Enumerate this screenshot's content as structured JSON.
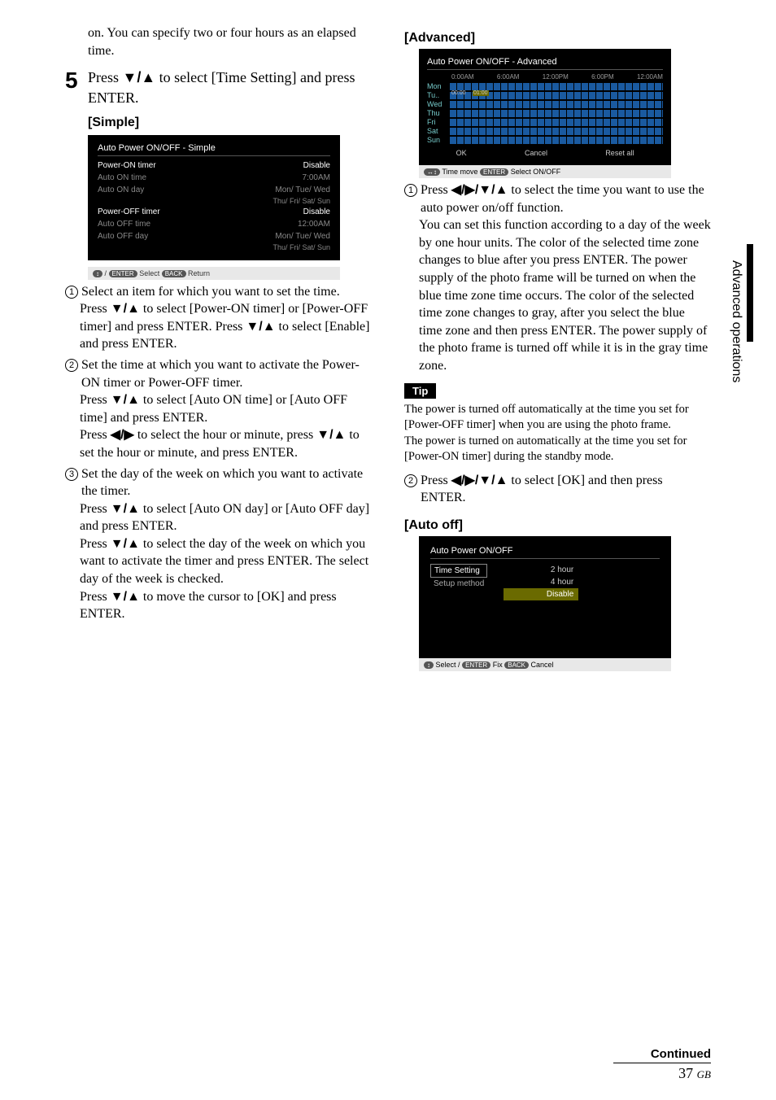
{
  "left": {
    "intro": "on. You can specify two or four hours as an elapsed time.",
    "step_number": "5",
    "step_text_a": "Press ",
    "step_arrows": "♦/♦",
    "step_text_b": " to select [Time Setting] and press ENTER.",
    "simple_label": "[Simple]",
    "simple_shot": {
      "title": "Auto Power ON/OFF - Simple",
      "r1_lab": "Power-ON timer",
      "r1_val": "Disable",
      "r2_lab": "Auto ON time",
      "r2_val": "7:00AM",
      "r3_lab": "Auto ON day",
      "r3_val": "Mon/  Tue/  Wed",
      "r3b": "Thu/   Fri/   Sat/   Sun",
      "r4_lab": "Power-OFF timer",
      "r4_val": "Disable",
      "r5_lab": "Auto OFF time",
      "r5_val": "12:00AM",
      "r6_lab": "Auto OFF day",
      "r6_val": "Mon/  Tue/  Wed",
      "r6b": "Thu/   Fri/   Sat/   Sun"
    },
    "hint": {
      "a": "↕",
      "b": "/",
      "enter": "ENTER",
      "sel": "Select",
      "back": "BACK",
      "ret": "Return"
    },
    "sub1": "Select an item for which you want to set the time.",
    "sub1b_a": "Press ",
    "sub1b_b": " to select [Power-ON timer] or [Power-OFF timer] and press ENTER. Press ",
    "sub1b_c": " to select [Enable] and press ENTER.",
    "sub2": "Set the time at which you want to activate the Power-ON timer or Power-OFF timer.",
    "sub2b_a": "Press ",
    "sub2b_b": " to select [Auto ON time] or [Auto OFF time] and press ENTER.",
    "sub2c_a": "Press ",
    "sub2c_b": " to select the hour or minute, press ",
    "sub2c_c": " to set the hour or minute, and press ENTER.",
    "sub3": "Set the day of the week on which you want to activate the timer.",
    "sub3b_a": "Press ",
    "sub3b_b": " to select [Auto ON day] or [Auto OFF day] and press ENTER.",
    "sub3c_a": "Press ",
    "sub3c_b": " to select the day of the week on which you want to activate the timer and press ENTER. The select day of the week is checked.",
    "sub3d_a": "Press ",
    "sub3d_b": " to move the cursor to [OK] and press ENTER."
  },
  "right": {
    "adv_label": "[Advanced]",
    "adv_shot": {
      "title": "Auto Power ON/OFF - Advanced",
      "times": [
        "0:00AM",
        "6:00AM",
        "12:00PM",
        "6:00PM",
        "12:00AM"
      ],
      "days": [
        "Mon",
        "Tu..",
        "Wed",
        "Thu",
        "Fri",
        "Sat",
        "Sun"
      ],
      "time_a": "00:00",
      "time_b": "01:00",
      "ok": "OK",
      "cancel": "Cancel",
      "reset": "Reset all"
    },
    "adv_hint": {
      "move": "Time move",
      "enter": "ENTER",
      "sel": "Select ON/OFF"
    },
    "adv1_a": "Press ",
    "adv1_b": " to select the time you want to use the auto power on/off function.",
    "adv1_body": "You can set this function according to a day of the week by one hour units. The color of the selected time zone changes to blue after you press ENTER. The power supply of the photo frame will be turned on when the blue time zone time occurs. The color of the selected time zone changes to gray, after you select the blue time zone and then press ENTER. The power supply of the photo frame is turned off while it is in the gray time zone.",
    "tip_label": "Tip",
    "tip_body": "The power is turned off automatically at the time you set for [Power-OFF timer] when you are using the photo frame.\nThe power is turned on automatically at the time you set for [Power-ON timer] during the standby mode.",
    "adv2_a": "Press ",
    "adv2_b": " to select [OK] and then press ENTER.",
    "autooff_label": "[Auto off]",
    "autooff_shot": {
      "title": "Auto Power ON/OFF",
      "left1": "Time Setting",
      "left2": "Setup method",
      "r1": "2 hour",
      "r2": "4 hour",
      "r3": "Disable"
    },
    "autooff_hint": {
      "sel": "Select",
      "slash": "/",
      "enter": "ENTER",
      "fix": "Fix",
      "back": "BACK",
      "cancel": "Cancel"
    },
    "continued": "Continued",
    "pagenum": "37",
    "gb": "GB",
    "sidetab": "Advanced operations"
  },
  "glyph": {
    "ud": "♦/♦",
    "lr": "♦/♦",
    "all": "♦/♦/♦/♦"
  }
}
